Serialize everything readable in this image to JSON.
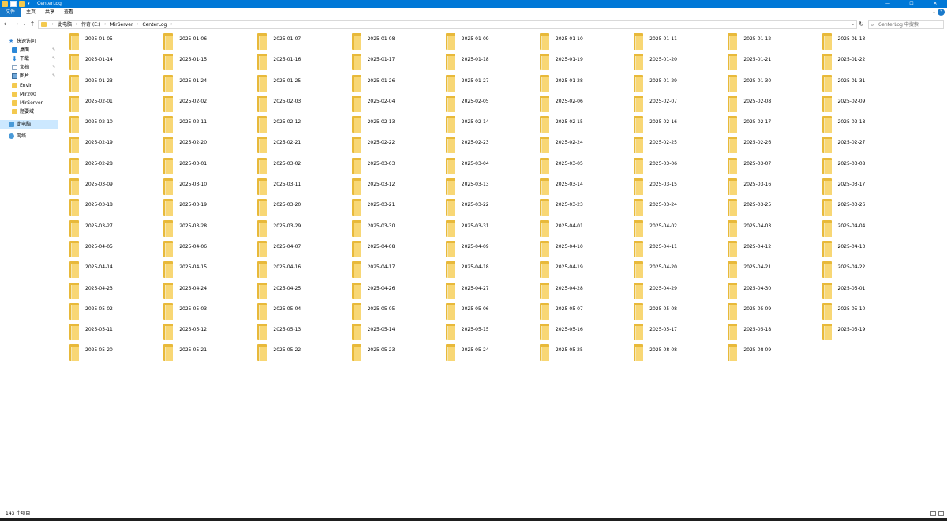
{
  "window": {
    "title": "CenterLog",
    "controls": {
      "minimize": "—",
      "maximize": "☐",
      "close": "✕"
    },
    "quick_access_dropdown": "▾"
  },
  "ribbon": {
    "tabs": [
      "文件",
      "主页",
      "共享",
      "查看"
    ],
    "expand": "⌄",
    "help": "?"
  },
  "navigation": {
    "back": "←",
    "forward": "→",
    "recent": "⌄",
    "up": "↑",
    "breadcrumbs": [
      "此电脑",
      "传奇 (E:)",
      "MirServer",
      "CenterLog"
    ],
    "separator": "›",
    "address_dropdown": "⌄",
    "refresh": "↻",
    "search_placeholder": "CenterLog 中搜索",
    "search_icon": "⌕"
  },
  "sidebar": {
    "items": [
      {
        "label": "快速访问",
        "icon": "star-icon",
        "pinned": false
      },
      {
        "label": "桌面",
        "icon": "desktop-icon",
        "pinned": true
      },
      {
        "label": "下载",
        "icon": "download-icon",
        "pinned": true
      },
      {
        "label": "文档",
        "icon": "documents-icon",
        "pinned": true
      },
      {
        "label": "图片",
        "icon": "pictures-icon",
        "pinned": true
      },
      {
        "label": "Envir",
        "icon": "folder-icon",
        "pinned": false
      },
      {
        "label": "Mir200",
        "icon": "folder-icon",
        "pinned": false
      },
      {
        "label": "MirServer",
        "icon": "folder-icon",
        "pinned": false
      },
      {
        "label": "题要域",
        "icon": "folder-icon",
        "pinned": false
      },
      {
        "label": "此电脑",
        "icon": "this-pc-icon",
        "pinned": false,
        "selected": true
      },
      {
        "label": "网络",
        "icon": "network-icon",
        "pinned": false
      }
    ],
    "pin_glyph": "✎"
  },
  "folders": [
    "2025-01-05",
    "2025-01-06",
    "2025-01-07",
    "2025-01-08",
    "2025-01-09",
    "2025-01-10",
    "2025-01-11",
    "2025-01-12",
    "2025-01-13",
    "2025-01-14",
    "2025-01-15",
    "2025-01-16",
    "2025-01-17",
    "2025-01-18",
    "2025-01-19",
    "2025-01-20",
    "2025-01-21",
    "2025-01-22",
    "2025-01-23",
    "2025-01-24",
    "2025-01-25",
    "2025-01-26",
    "2025-01-27",
    "2025-01-28",
    "2025-01-29",
    "2025-01-30",
    "2025-01-31",
    "2025-02-01",
    "2025-02-02",
    "2025-02-03",
    "2025-02-04",
    "2025-02-05",
    "2025-02-06",
    "2025-02-07",
    "2025-02-08",
    "2025-02-09",
    "2025-02-10",
    "2025-02-11",
    "2025-02-12",
    "2025-02-13",
    "2025-02-14",
    "2025-02-15",
    "2025-02-16",
    "2025-02-17",
    "2025-02-18",
    "2025-02-19",
    "2025-02-20",
    "2025-02-21",
    "2025-02-22",
    "2025-02-23",
    "2025-02-24",
    "2025-02-25",
    "2025-02-26",
    "2025-02-27",
    "2025-02-28",
    "2025-03-01",
    "2025-03-02",
    "2025-03-03",
    "2025-03-04",
    "2025-03-05",
    "2025-03-06",
    "2025-03-07",
    "2025-03-08",
    "2025-03-09",
    "2025-03-10",
    "2025-03-11",
    "2025-03-12",
    "2025-03-13",
    "2025-03-14",
    "2025-03-15",
    "2025-03-16",
    "2025-03-17",
    "2025-03-18",
    "2025-03-19",
    "2025-03-20",
    "2025-03-21",
    "2025-03-22",
    "2025-03-23",
    "2025-03-24",
    "2025-03-25",
    "2025-03-26",
    "2025-03-27",
    "2025-03-28",
    "2025-03-29",
    "2025-03-30",
    "2025-03-31",
    "2025-04-01",
    "2025-04-02",
    "2025-04-03",
    "2025-04-04",
    "2025-04-05",
    "2025-04-06",
    "2025-04-07",
    "2025-04-08",
    "2025-04-09",
    "2025-04-10",
    "2025-04-11",
    "2025-04-12",
    "2025-04-13",
    "2025-04-14",
    "2025-04-15",
    "2025-04-16",
    "2025-04-17",
    "2025-04-18",
    "2025-04-19",
    "2025-04-20",
    "2025-04-21",
    "2025-04-22",
    "2025-04-23",
    "2025-04-24",
    "2025-04-25",
    "2025-04-26",
    "2025-04-27",
    "2025-04-28",
    "2025-04-29",
    "2025-04-30",
    "2025-05-01",
    "2025-05-02",
    "2025-05-03",
    "2025-05-04",
    "2025-05-05",
    "2025-05-06",
    "2025-05-07",
    "2025-05-08",
    "2025-05-09",
    "2025-05-10",
    "2025-05-11",
    "2025-05-12",
    "2025-05-13",
    "2025-05-14",
    "2025-05-15",
    "2025-05-16",
    "2025-05-17",
    "2025-05-18",
    "2025-05-19",
    "2025-05-20",
    "2025-05-21",
    "2025-05-22",
    "2025-05-23",
    "2025-05-24",
    "2025-05-25",
    "2025-08-08",
    "2025-08-09"
  ],
  "status": {
    "item_count": "143 个项目"
  },
  "colors": {
    "accent": "#0078d7",
    "folder": "#f8d775",
    "selection": "#cce8ff"
  }
}
